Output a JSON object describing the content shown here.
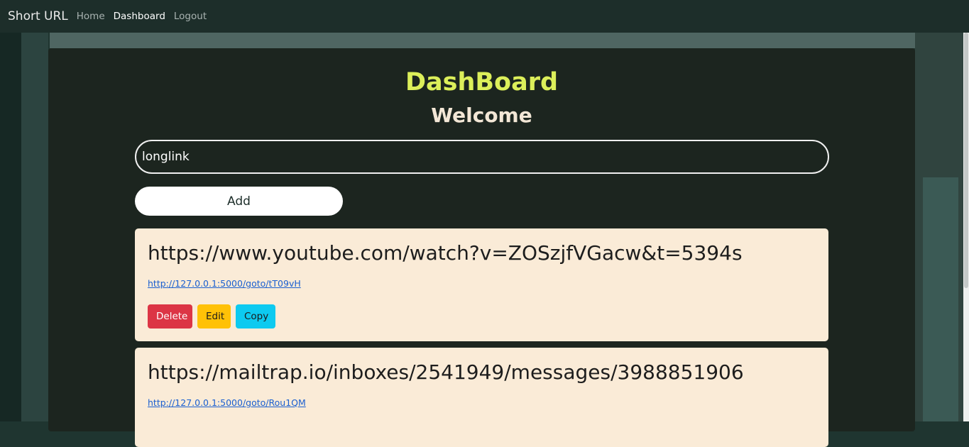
{
  "nav": {
    "brand": "Short URL",
    "links": [
      {
        "label": "Home"
      },
      {
        "label": "Dashboard"
      },
      {
        "label": "Logout"
      }
    ]
  },
  "page": {
    "title": "DashBoard",
    "subtitle": "Welcome"
  },
  "form": {
    "input_value": "longlink",
    "add_label": "Add"
  },
  "links": [
    {
      "long_url": "https://www.youtube.com/watch?v=ZOSzjfVGacw&t=5394s",
      "short_url": "http://127.0.0.1:5000/goto/tT09vH",
      "delete_label": "Delete",
      "edit_label": "Edit",
      "copy_label": "Copy"
    },
    {
      "long_url": "https://mailtrap.io/inboxes/2541949/messages/3988851906",
      "short_url": "http://127.0.0.1:5000/goto/Rou1QM"
    }
  ],
  "colors": {
    "title": "#dcef5a",
    "card_bg": "#faebd7",
    "delete": "#dc3545",
    "edit": "#ffc107",
    "copy": "#0dcaf0"
  }
}
